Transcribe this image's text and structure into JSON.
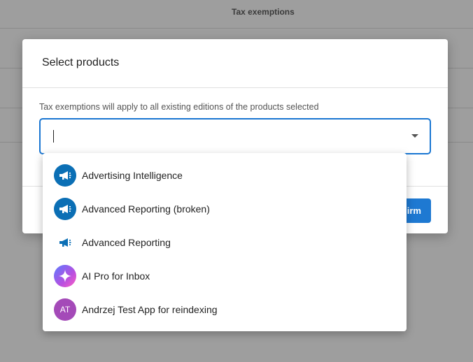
{
  "background": {
    "column_header": "Tax exemptions"
  },
  "dialog": {
    "title": "Select products",
    "helper_text": "Tax exemptions will apply to all existing editions of the products selected",
    "search_value": "",
    "confirm_label": "Confirm",
    "confirm_visible_label": "irm"
  },
  "dropdown": {
    "items": [
      {
        "label": "Advertising Intelligence",
        "icon": "megaphone-icon"
      },
      {
        "label": "Advanced Reporting (broken)",
        "icon": "megaphone-icon"
      },
      {
        "label": "Advanced Reporting",
        "icon": "megaphone-icon"
      },
      {
        "label": "AI Pro for Inbox",
        "icon": "sparkle-icon"
      },
      {
        "label": "Andrzej Test App for reindexing",
        "icon": "initials-avatar",
        "initials": "AT"
      }
    ]
  },
  "colors": {
    "accent": "#1976d2",
    "product_blue": "#0b6fb5",
    "avatar_purple": "#a44ab8",
    "overlay": "#9e9e9e"
  }
}
